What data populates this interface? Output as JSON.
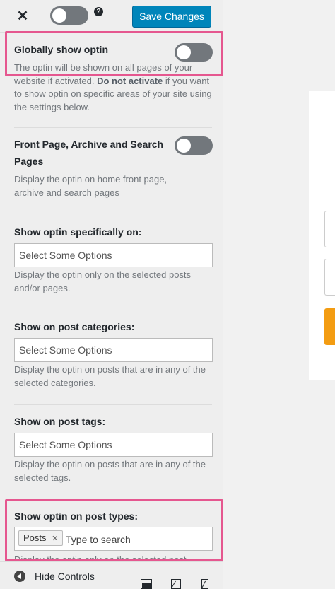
{
  "header": {
    "close_icon": "close-icon",
    "help_icon_text": "?",
    "save_label": "Save Changes"
  },
  "sections": {
    "global": {
      "title": "Globally show optin",
      "desc_1": "The optin will be shown on all pages of your website if activated.",
      "desc_bold": "Do not activate",
      "desc_2": "if you want to show optin on specific areas of your site using the settings below.",
      "toggle_on": false
    },
    "front": {
      "title": "Front Page, Archive and Search Pages",
      "desc": "Display the optin on home front page, archive and search pages",
      "toggle_on": false
    },
    "specific": {
      "title": "Show optin specifically on:",
      "placeholder": "Select Some Options",
      "desc": "Display the optin only on the selected posts and/or pages."
    },
    "categories": {
      "title": "Show on post categories:",
      "placeholder": "Select Some Options",
      "desc": "Display the optin on posts that are in any of the selected categories."
    },
    "tags": {
      "title": "Show on post tags:",
      "placeholder": "Select Some Options",
      "desc": "Display the optin on posts that are in any of the selected tags."
    },
    "post_types": {
      "title": "Show optin on post types:",
      "chip": "Posts",
      "chip_remove": "✕",
      "search_placeholder": "Type to search",
      "desc": "Display the optin only on the selected post"
    }
  },
  "footer": {
    "hide_label": "Hide Controls"
  },
  "colors": {
    "accent": "#0085ba",
    "highlight": "#e5578f",
    "toggle_off": "#72777c",
    "preview_button": "#f39c12"
  }
}
